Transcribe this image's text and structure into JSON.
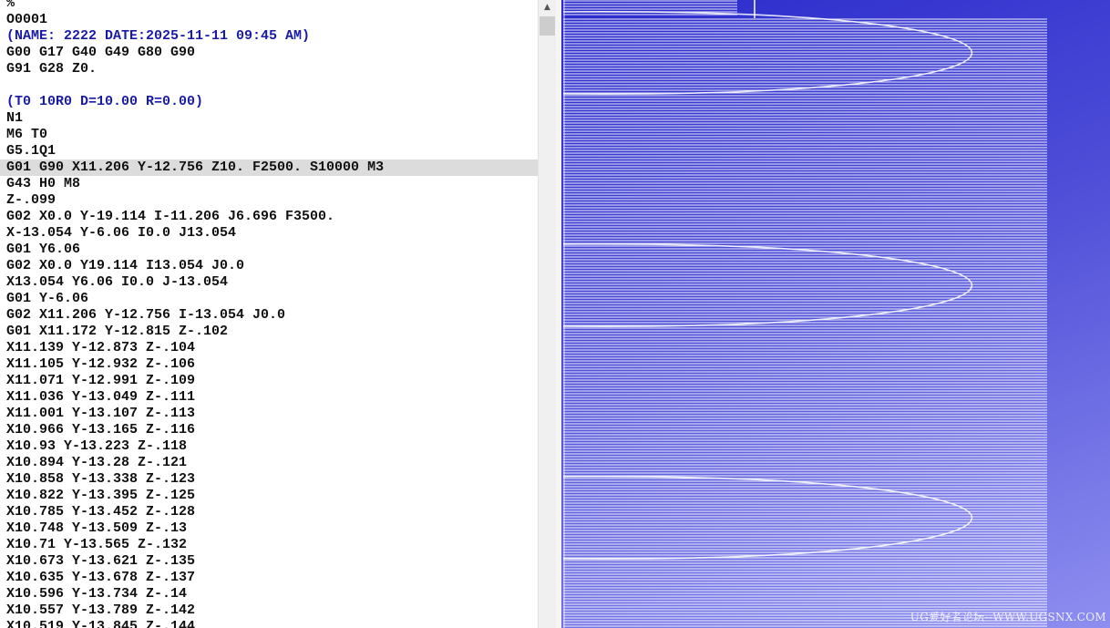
{
  "editor": {
    "lines": [
      "%",
      "O0001",
      "(NAME: 2222 DATE:2025-11-11 09:45 AM)",
      "G00 G17 G40 G49 G80 G90",
      "G91 G28 Z0.",
      "",
      "(T0 10R0 D=10.00 R=0.00)",
      "N1",
      "M6 T0",
      "G5.1Q1",
      "G01 G90 X11.206 Y-12.756 Z10. F2500. S10000 M3",
      "G43 H0 M8",
      "Z-.099",
      "G02 X0.0 Y-19.114 I-11.206 J6.696 F3500.",
      "X-13.054 Y-6.06 I0.0 J13.054",
      "G01 Y6.06",
      "G02 X0.0 Y19.114 I13.054 J0.0",
      "X13.054 Y6.06 I0.0 J-13.054",
      "G01 Y-6.06",
      "G02 X11.206 Y-12.756 I-13.054 J0.0",
      "G01 X11.172 Y-12.815 Z-.102",
      "X11.139 Y-12.873 Z-.104",
      "X11.105 Y-12.932 Z-.106",
      "X11.071 Y-12.991 Z-.109",
      "X11.036 Y-13.049 Z-.111",
      "X11.001 Y-13.107 Z-.113",
      "X10.966 Y-13.165 Z-.116",
      "X10.93 Y-13.223 Z-.118",
      "X10.894 Y-13.28 Z-.121",
      "X10.858 Y-13.338 Z-.123",
      "X10.822 Y-13.395 Z-.125",
      "X10.785 Y-13.452 Z-.128",
      "X10.748 Y-13.509 Z-.13",
      "X10.71 Y-13.565 Z-.132",
      "X10.673 Y-13.621 Z-.135",
      "X10.635 Y-13.678 Z-.137",
      "X10.596 Y-13.734 Z-.14",
      "X10.557 Y-13.789 Z-.142",
      "X10.519 Y-13.845 Z-.144"
    ],
    "comment_lines": [
      2,
      6
    ],
    "highlighted_line": 10,
    "scroll": {
      "up_icon": "scroll-up-arrow-icon"
    }
  },
  "viewer": {
    "background_gradient": [
      "#2a2acc",
      "#4e4ed8",
      "#8e8ef0"
    ],
    "toolpath_color": "#ffffff",
    "watermark": "UG爱好者论坛--WWW.UGSNX.COM"
  }
}
